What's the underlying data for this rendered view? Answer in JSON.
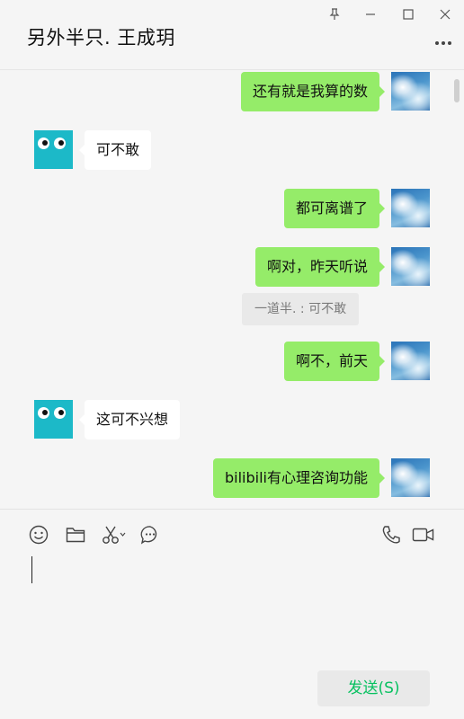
{
  "window": {
    "title": "另外半只. 王成玥",
    "buttons": {
      "pin_icon": "pin-icon",
      "minimize_icon": "minimize-icon",
      "maximize_icon": "maximize-icon",
      "close_icon": "close-icon",
      "more_icon": "more-icon"
    }
  },
  "messages": [
    {
      "sender": "me",
      "text": "还有就是我算的数"
    },
    {
      "sender": "other",
      "text": "可不敢"
    },
    {
      "sender": "me",
      "text": "都可离谱了"
    },
    {
      "sender": "me",
      "text": "啊对，昨天听说",
      "quote": "一道半. : 可不敢"
    },
    {
      "sender": "me",
      "text": "啊不，前天"
    },
    {
      "sender": "other",
      "text": "这可不兴想"
    },
    {
      "sender": "me",
      "text": "bilibili有心理咨询功能"
    }
  ],
  "toolbar": {
    "icons": [
      "emoji-icon",
      "folder-icon",
      "scissors-icon",
      "chat-history-icon",
      "phone-icon",
      "video-icon"
    ]
  },
  "composer": {
    "send_label": "发送(S)"
  },
  "colors": {
    "my_bubble": "#95ec69",
    "their_bubble": "#ffffff",
    "send_text": "#07c160",
    "background": "#f5f5f5"
  }
}
